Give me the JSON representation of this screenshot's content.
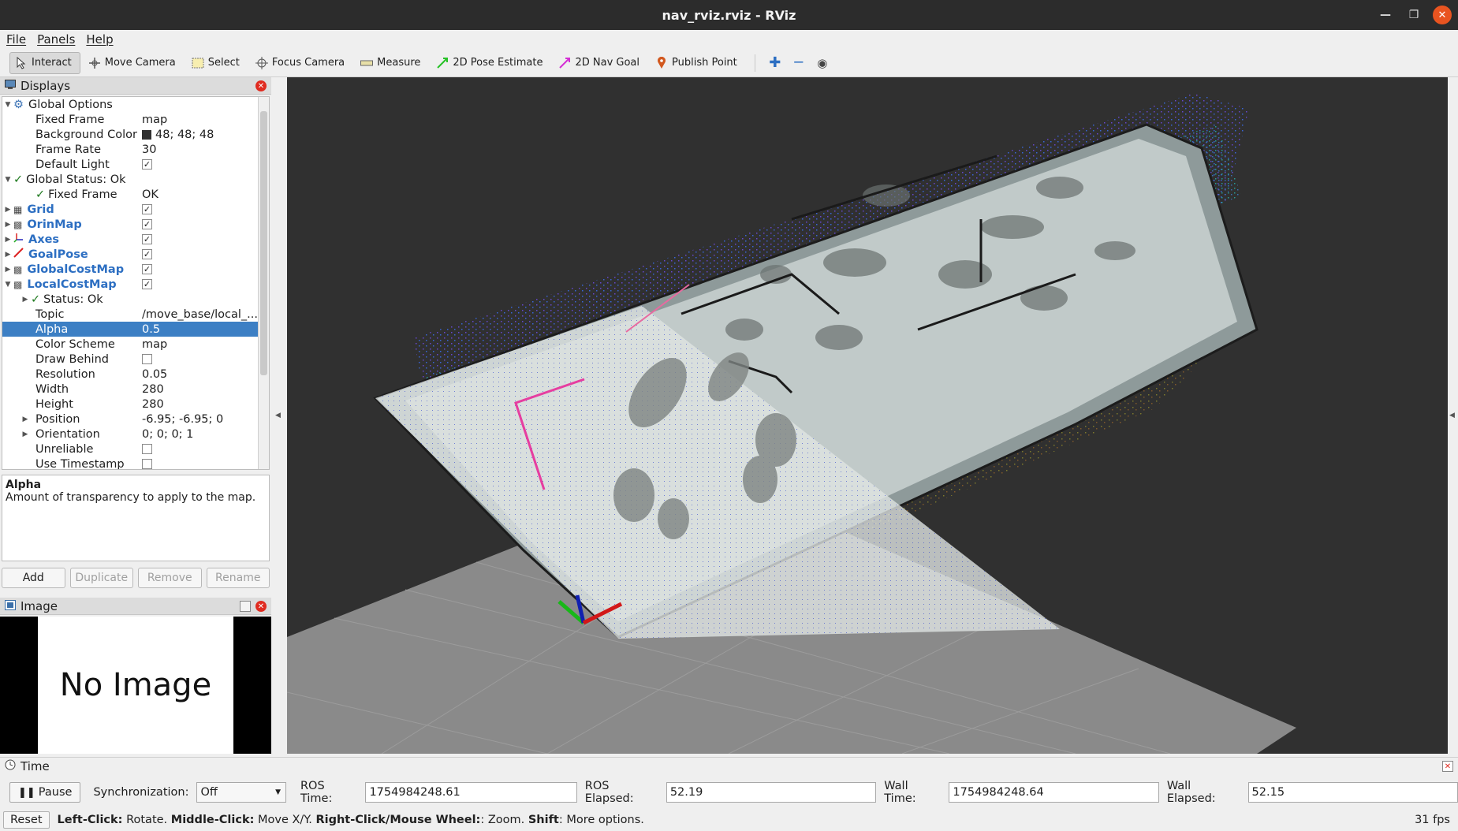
{
  "window": {
    "title": "nav_rviz.rviz - RViz"
  },
  "menu": {
    "file": "File",
    "panels": "Panels",
    "help": "Help"
  },
  "toolbar": {
    "interact": "Interact",
    "move_camera": "Move Camera",
    "select": "Select",
    "focus_camera": "Focus Camera",
    "measure": "Measure",
    "pose_estimate": "2D Pose Estimate",
    "nav_goal": "2D Nav Goal",
    "publish_point": "Publish Point"
  },
  "displays": {
    "title": "Displays",
    "global_options": {
      "label": "Global Options",
      "fixed_frame": {
        "label": "Fixed Frame",
        "value": "map"
      },
      "background_color": {
        "label": "Background Color",
        "value": "48; 48; 48"
      },
      "frame_rate": {
        "label": "Frame Rate",
        "value": "30"
      },
      "default_light": {
        "label": "Default Light",
        "value": "✓"
      }
    },
    "global_status": {
      "label": "Global Status: Ok",
      "fixed_frame": {
        "label": "Fixed Frame",
        "value": "OK"
      }
    },
    "items": [
      {
        "label": "Grid",
        "value": "✓"
      },
      {
        "label": "OrinMap",
        "value": "✓"
      },
      {
        "label": "Axes",
        "value": "✓"
      },
      {
        "label": "GoalPose",
        "value": "✓"
      },
      {
        "label": "GlobalCostMap",
        "value": "✓"
      },
      {
        "label": "LocalCostMap",
        "value": "✓"
      }
    ],
    "local_costmap": {
      "status": "Status: Ok",
      "props": [
        {
          "label": "Topic",
          "value": "/move_base/local_..."
        },
        {
          "label": "Alpha",
          "value": "0.5"
        },
        {
          "label": "Color Scheme",
          "value": "map"
        },
        {
          "label": "Draw Behind",
          "value": ""
        },
        {
          "label": "Resolution",
          "value": "0.05"
        },
        {
          "label": "Width",
          "value": "280"
        },
        {
          "label": "Height",
          "value": "280"
        },
        {
          "label": "Position",
          "value": "-6.95; -6.95; 0"
        },
        {
          "label": "Orientation",
          "value": "0; 0; 0; 1"
        },
        {
          "label": "Unreliable",
          "value": ""
        },
        {
          "label": "Use Timestamp",
          "value": ""
        }
      ]
    },
    "description": {
      "title": "Alpha",
      "text": "Amount of transparency to apply to the map."
    },
    "buttons": {
      "add": "Add",
      "duplicate": "Duplicate",
      "remove": "Remove",
      "rename": "Rename"
    }
  },
  "image_panel": {
    "title": "Image",
    "placeholder": "No Image"
  },
  "time": {
    "title": "Time",
    "pause": "Pause",
    "sync_label": "Synchronization:",
    "sync_value": "Off",
    "ros_time_label": "ROS Time:",
    "ros_time": "1754984248.61",
    "ros_elapsed_label": "ROS Elapsed:",
    "ros_elapsed": "52.19",
    "wall_time_label": "Wall Time:",
    "wall_time": "1754984248.64",
    "wall_elapsed_label": "Wall Elapsed:",
    "wall_elapsed": "52.15"
  },
  "status": {
    "reset": "Reset",
    "hint_left_key": "Left-Click:",
    "hint_left": " Rotate. ",
    "hint_middle_key": "Middle-Click:",
    "hint_middle": " Move X/Y. ",
    "hint_right_key": "Right-Click/Mouse Wheel:",
    "hint_right": ": Zoom. ",
    "hint_shift_key": "Shift",
    "hint_shift": ": More options.",
    "fps": "31 fps"
  },
  "colors": {
    "viewport_bg": "#303030",
    "selection": "#3c7fc4",
    "accent": "#2d6fc2"
  }
}
